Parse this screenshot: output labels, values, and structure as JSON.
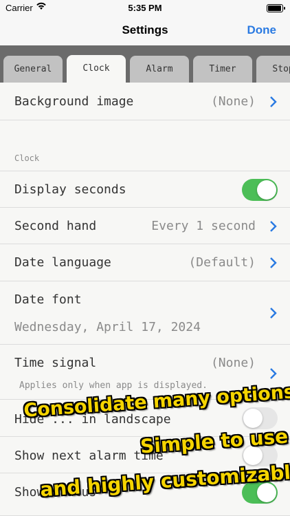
{
  "status_bar": {
    "carrier": "Carrier",
    "time": "5:35 PM",
    "battery_level": 1.0
  },
  "nav": {
    "title": "Settings",
    "done_label": "Done"
  },
  "tabs": [
    {
      "label": "General",
      "active": false
    },
    {
      "label": "Clock",
      "active": true
    },
    {
      "label": "Alarm",
      "active": false
    },
    {
      "label": "Timer",
      "active": false
    },
    {
      "label": "Stopw",
      "active": false
    }
  ],
  "rows": {
    "background_image": {
      "label": "Background image",
      "value": "(None)"
    },
    "section_clock": "Clock",
    "display_seconds": {
      "label": "Display seconds",
      "on": true
    },
    "second_hand": {
      "label": "Second hand",
      "value": "Every 1 second"
    },
    "date_language": {
      "label": "Date language",
      "value": "(Default)"
    },
    "date_font": {
      "label": "Date font",
      "sample": "Wednesday, April 17, 2024"
    },
    "time_signal": {
      "label": "Time signal",
      "value": "(None)",
      "note": "Applies only when app is displayed."
    },
    "hide_landscape": {
      "label": "Hide ... in landscape",
      "on": false
    },
    "show_next_alarm": {
      "label": "Show next alarm time",
      "on": false
    },
    "show_status": {
      "label": "Show status",
      "on": true
    }
  },
  "promo": {
    "line1": "Consolidate many options",
    "line2": "Simple to use",
    "line3": "and highly customizable"
  },
  "colors": {
    "accent": "#2a7ae2",
    "toggle_on": "#4cbe57",
    "promo_text": "#f5d400"
  }
}
